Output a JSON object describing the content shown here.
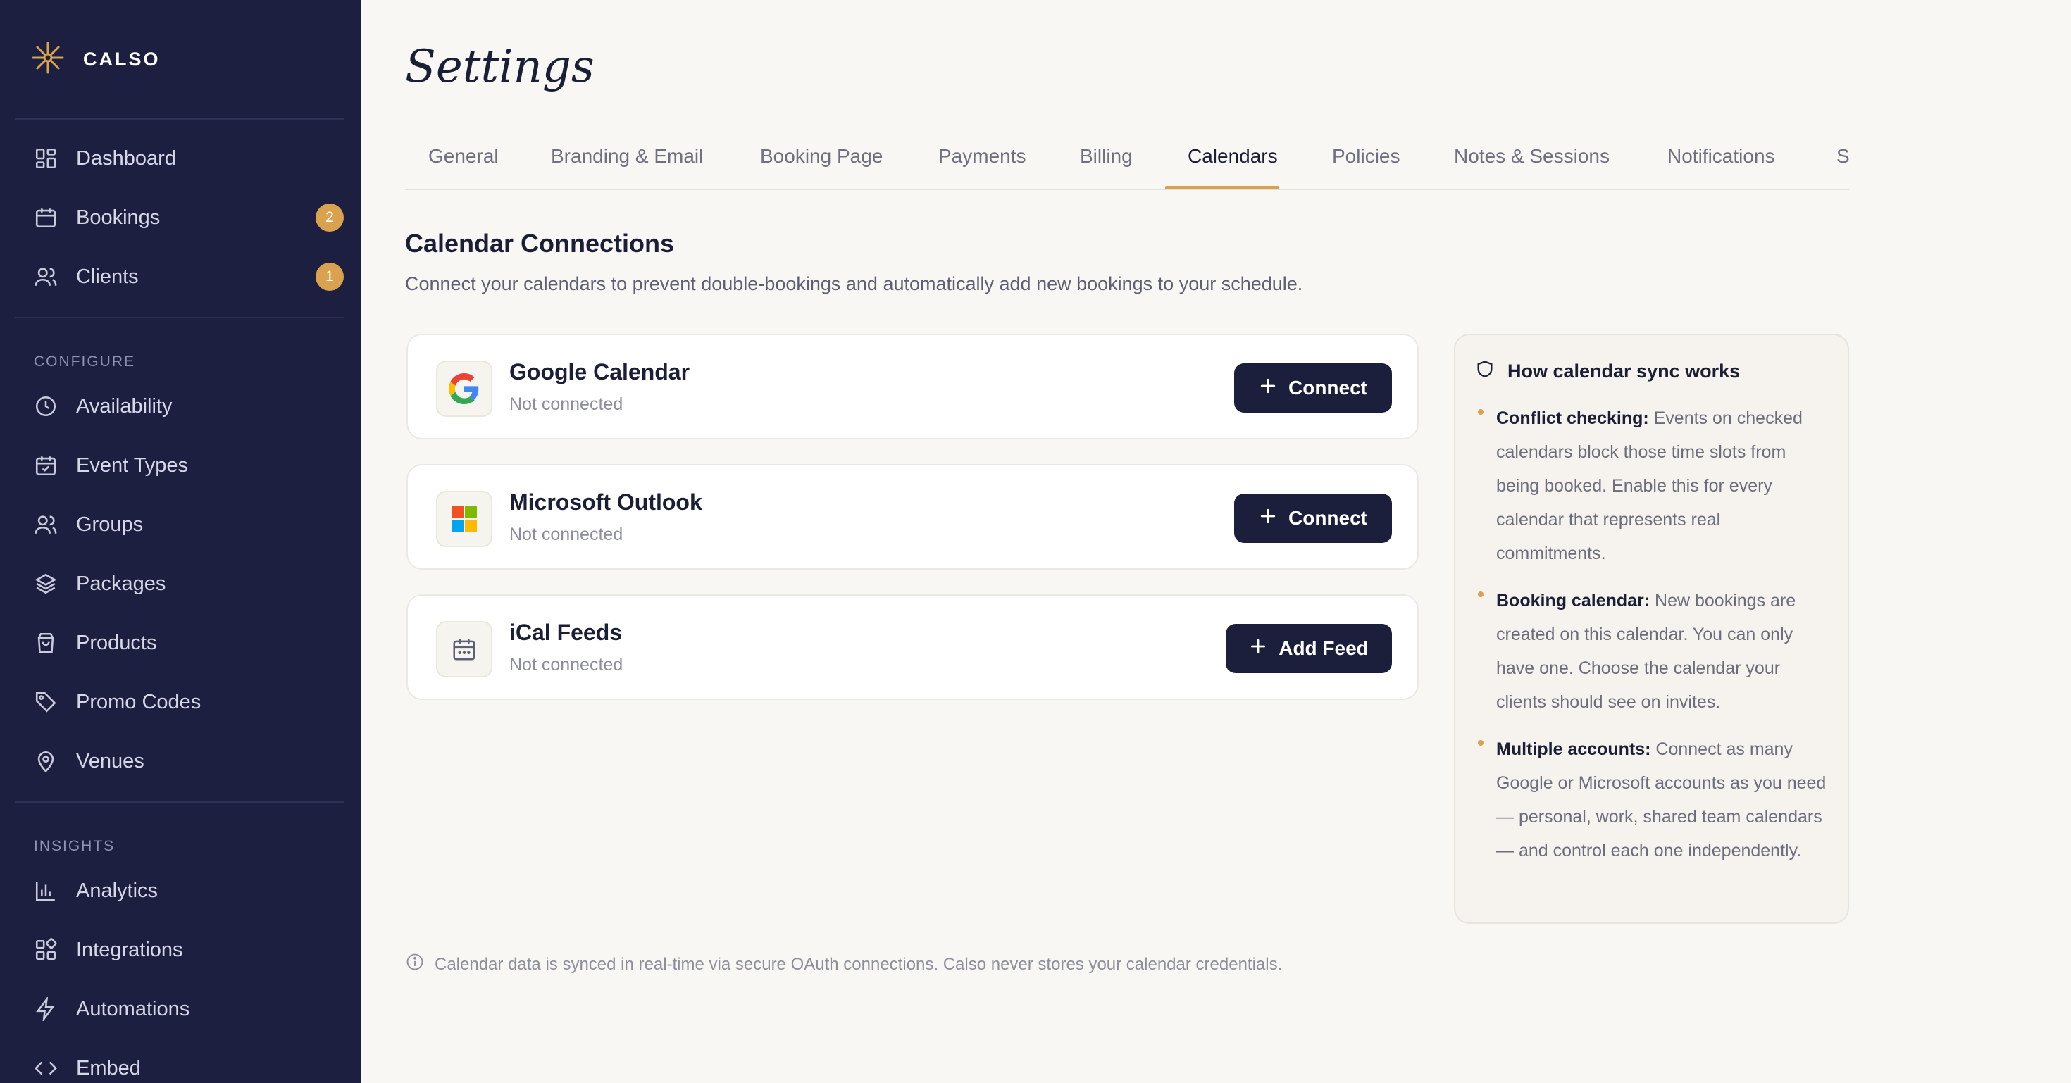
{
  "app": {
    "name": "CALSO"
  },
  "sidebar": {
    "main_items": [
      {
        "label": "Dashboard",
        "icon": "dashboard-icon"
      },
      {
        "label": "Bookings",
        "icon": "calendar-icon",
        "badge": "2"
      },
      {
        "label": "Clients",
        "icon": "users-icon",
        "badge": "1"
      }
    ],
    "configure_heading": "CONFIGURE",
    "configure_items": [
      {
        "label": "Availability",
        "icon": "clock-icon"
      },
      {
        "label": "Event Types",
        "icon": "calendar-check-icon"
      },
      {
        "label": "Groups",
        "icon": "group-icon"
      },
      {
        "label": "Packages",
        "icon": "layers-icon"
      },
      {
        "label": "Products",
        "icon": "shopping-bag-icon"
      },
      {
        "label": "Promo Codes",
        "icon": "tag-icon"
      },
      {
        "label": "Venues",
        "icon": "map-pin-icon"
      }
    ],
    "insights_heading": "INSIGHTS",
    "insights_items": [
      {
        "label": "Analytics",
        "icon": "bar-chart-icon"
      },
      {
        "label": "Integrations",
        "icon": "integrations-icon"
      },
      {
        "label": "Automations",
        "icon": "zap-icon"
      },
      {
        "label": "Embed",
        "icon": "code-icon"
      }
    ]
  },
  "page": {
    "title": "Settings"
  },
  "tabs": [
    "General",
    "Branding & Email",
    "Booking Page",
    "Payments",
    "Billing",
    "Calendars",
    "Policies",
    "Notes & Sessions",
    "Notifications",
    "S"
  ],
  "active_tab": "Calendars",
  "section": {
    "title": "Calendar Connections",
    "description": "Connect your calendars to prevent double-bookings and automatically add new bookings to your schedule."
  },
  "connections": [
    {
      "name": "Google Calendar",
      "status": "Not connected",
      "button": "Connect",
      "icon": "google-icon"
    },
    {
      "name": "Microsoft Outlook",
      "status": "Not connected",
      "button": "Connect",
      "icon": "microsoft-icon"
    },
    {
      "name": "iCal Feeds",
      "status": "Not connected",
      "button": "Add Feed",
      "icon": "ical-calendar-icon"
    }
  ],
  "info_panel": {
    "title": "How calendar sync works",
    "items": [
      {
        "bold": "Conflict checking:",
        "text": " Events on checked calendars block those time slots from being booked. Enable this for every calendar that represents real commitments."
      },
      {
        "bold": "Booking calendar:",
        "text": " New bookings are created on this calendar. You can only have one. Choose the calendar your clients should see on invites."
      },
      {
        "bold": "Multiple accounts:",
        "text": " Connect as many Google or Microsoft accounts as you need — personal, work, shared team calendars — and control each one independently."
      }
    ]
  },
  "footnote": "Calendar data is synced in real-time via secure OAuth connections. Calso never stores your calendar credentials.",
  "colors": {
    "sidebar_bg": "#1c1f3f",
    "accent": "#d9a24e",
    "button_bg": "#1b1f3b",
    "page_bg": "#f8f7f4"
  }
}
